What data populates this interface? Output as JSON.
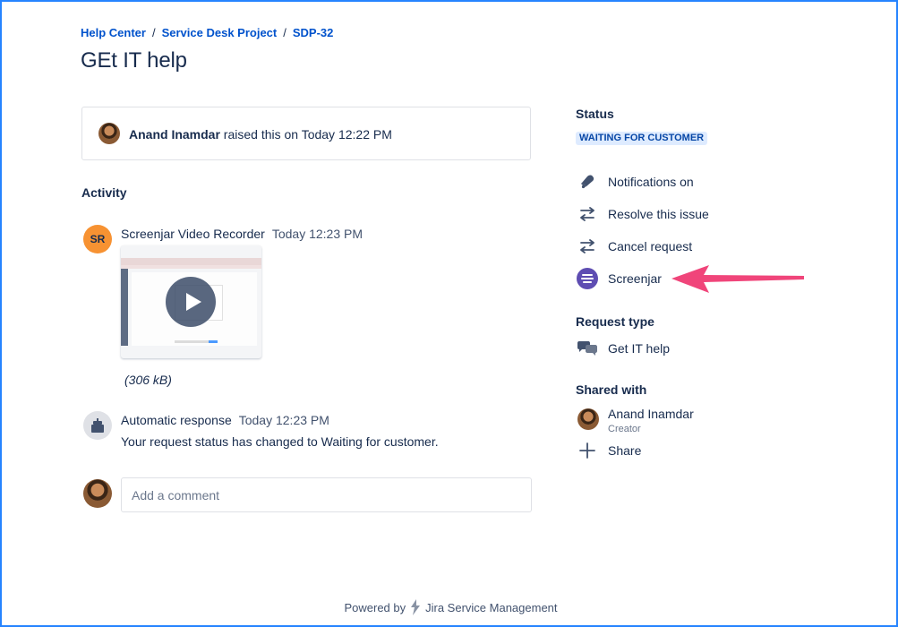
{
  "breadcrumb": {
    "items": [
      "Help Center",
      "Service Desk Project",
      "SDP-32"
    ],
    "separator": "/"
  },
  "page_title": "GEt IT help",
  "request_card": {
    "reporter_name": "Anand Inamdar",
    "raised_text": " raised this on Today 12:22 PM"
  },
  "activity": {
    "heading": "Activity",
    "items": [
      {
        "avatar_initials": "SR",
        "author": "Screenjar Video Recorder",
        "time": "Today 12:23 PM",
        "attachment_size": "(306 kB)"
      },
      {
        "author": "Automatic response",
        "time": "Today 12:23 PM",
        "body": "Your request status has changed to Waiting for customer."
      }
    ]
  },
  "comment": {
    "placeholder": "Add a comment"
  },
  "sidebar": {
    "status_heading": "Status",
    "status_value": "WAITING FOR CUSTOMER",
    "actions": [
      {
        "label": "Notifications on",
        "icon": "bell-icon"
      },
      {
        "label": "Resolve this issue",
        "icon": "transition-arrows-icon"
      },
      {
        "label": "Cancel request",
        "icon": "transition-arrows-icon"
      },
      {
        "label": "Screenjar",
        "icon": "screenjar-icon"
      }
    ],
    "request_type_heading": "Request type",
    "request_type": "Get IT help",
    "shared_heading": "Shared with",
    "shared_person_name": "Anand Inamdar",
    "shared_person_role": "Creator",
    "share_label": "Share"
  },
  "footer": {
    "prefix": "Powered by",
    "product": "Jira Service Management"
  },
  "colors": {
    "link": "#0052cc",
    "text": "#172b4d",
    "lozenge_bg": "#deebff",
    "lozenge_text": "#0747a6",
    "annotation_arrow": "#f0457a",
    "frame_border": "#2684ff"
  }
}
